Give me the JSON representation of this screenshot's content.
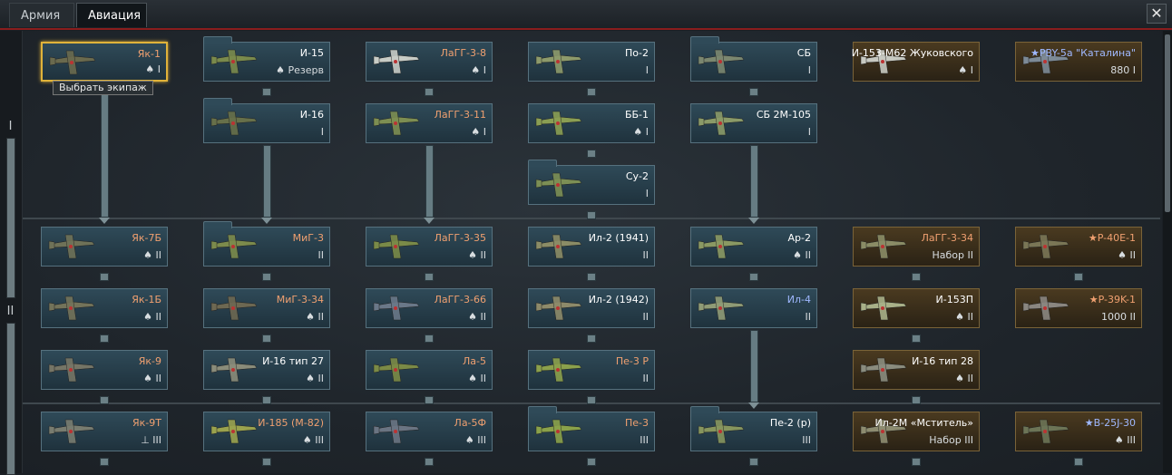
{
  "tabs": [
    {
      "label": "Армия"
    },
    {
      "label": "Авиация"
    }
  ],
  "close_label": "✕",
  "ranks": [
    "I",
    "II"
  ],
  "tooltip": "Выбрать экипаж",
  "rows": [
    [
      {
        "name": "Як-1",
        "sub": "♠ I",
        "cls": "orange sel",
        "c": "#6a6a4e"
      },
      {
        "name": "И-15",
        "sub": "♠ Резерв",
        "cls": "white folder",
        "c": "#7a8a4c"
      },
      {
        "name": "ЛаГГ-3-8",
        "sub": "♠ I",
        "cls": "orange",
        "c": "#c8ccc6"
      },
      {
        "name": "По-2",
        "sub": "I",
        "cls": "white",
        "c": "#8d9a6b"
      },
      {
        "name": "СБ",
        "sub": "I",
        "cls": "white folder",
        "c": "#7b8770"
      },
      {
        "name": "И-153-М62 Жуковского",
        "sub": "♠ I",
        "cls": "white prem",
        "c": "#c7c9c1"
      },
      {
        "name": "★PBY-5a \"Каталина\"",
        "sub": "880 I",
        "cls": "blue prem",
        "c": "#7d8a96"
      }
    ],
    [
      null,
      {
        "name": "И-16",
        "sub": "I",
        "cls": "white folder",
        "c": "#67704a"
      },
      {
        "name": "ЛаГГ-3-11",
        "sub": "♠ I",
        "cls": "orange",
        "c": "#7d8e52"
      },
      {
        "name": "ББ-1",
        "sub": "♠ I",
        "cls": "white",
        "c": "#8a9e53"
      },
      {
        "name": "СБ 2М-105",
        "sub": "I",
        "cls": "white",
        "c": "#8a9a68"
      },
      null,
      null
    ],
    [
      null,
      null,
      null,
      {
        "name": "Су-2",
        "sub": "I",
        "cls": "white folder",
        "c": "#7c8f55"
      },
      null,
      null,
      null
    ],
    [
      {
        "name": "Як-7Б",
        "sub": "♠ II",
        "cls": "orange",
        "c": "#6f7258"
      },
      {
        "name": "МиГ-3",
        "sub": "II",
        "cls": "orange folder",
        "c": "#7c8b4c"
      },
      {
        "name": "ЛаГГ-3-35",
        "sub": "♠ II",
        "cls": "orange",
        "c": "#7a8a48"
      },
      {
        "name": "Ил-2 (1941)",
        "sub": "II",
        "cls": "white",
        "c": "#8b8c66"
      },
      {
        "name": "Ар-2",
        "sub": "♠ II",
        "cls": "white",
        "c": "#8a9963"
      },
      {
        "name": "ЛаГГ-3-34",
        "sub": "Набор II",
        "cls": "orange prem",
        "c": "#8a8c66"
      },
      {
        "name": "★P-40E-1",
        "sub": "♠ II",
        "cls": "orange prem",
        "c": "#7a7656"
      }
    ],
    [
      {
        "name": "Як-1Б",
        "sub": "♠ II",
        "cls": "orange",
        "c": "#73735a"
      },
      {
        "name": "МиГ-3-34",
        "sub": "♠ II",
        "cls": "orange",
        "c": "#6d6852"
      },
      {
        "name": "ЛаГГ-3-66",
        "sub": "♠ II",
        "cls": "orange",
        "c": "#6a7888"
      },
      {
        "name": "Ил-2 (1942)",
        "sub": "II",
        "cls": "white",
        "c": "#8d8a6a"
      },
      {
        "name": "Ил-4",
        "sub": "II",
        "cls": "blue",
        "c": "#8f9b76"
      },
      {
        "name": "И-153П",
        "sub": "♠ II",
        "cls": "white prem",
        "c": "#a8b088"
      },
      {
        "name": "★P-39K-1",
        "sub": "1000 II",
        "cls": "orange prem",
        "c": "#8a8680"
      }
    ],
    [
      {
        "name": "Як-9",
        "sub": "♠ II",
        "cls": "orange",
        "c": "#757566"
      },
      {
        "name": "И-16 тип 27",
        "sub": "♠ II",
        "cls": "white",
        "c": "#8a8c7a"
      },
      {
        "name": "Ла-5",
        "sub": "♠ II",
        "cls": "orange",
        "c": "#7b8a46"
      },
      {
        "name": "Пе-3 Р",
        "sub": "II",
        "cls": "orange",
        "c": "#8ba04c"
      },
      null,
      {
        "name": "И-16 тип 28",
        "sub": "♠ II",
        "cls": "white prem",
        "c": "#8a8c7e"
      },
      null
    ],
    [
      {
        "name": "Як-9Т",
        "sub": "⊥ III",
        "cls": "orange",
        "c": "#787c70"
      },
      {
        "name": "И-185 (М-82)",
        "sub": "♠ III",
        "cls": "orange",
        "c": "#9aa24e"
      },
      {
        "name": "Ла-5Ф",
        "sub": "♠ III",
        "cls": "orange",
        "c": "#6a7482"
      },
      {
        "name": "Пе-3",
        "sub": "III",
        "cls": "orange folder",
        "c": "#8aa14a"
      },
      {
        "name": "Пе-2 (р)",
        "sub": "III",
        "cls": "white folder",
        "c": "#86955e"
      },
      {
        "name": "Ил-2М «Мститель»",
        "sub": "Набор III",
        "cls": "white prem",
        "c": "#8d8c70"
      },
      {
        "name": "★B-25J-30",
        "sub": "♠ III",
        "cls": "blue prem",
        "c": "#6c7456"
      }
    ]
  ]
}
